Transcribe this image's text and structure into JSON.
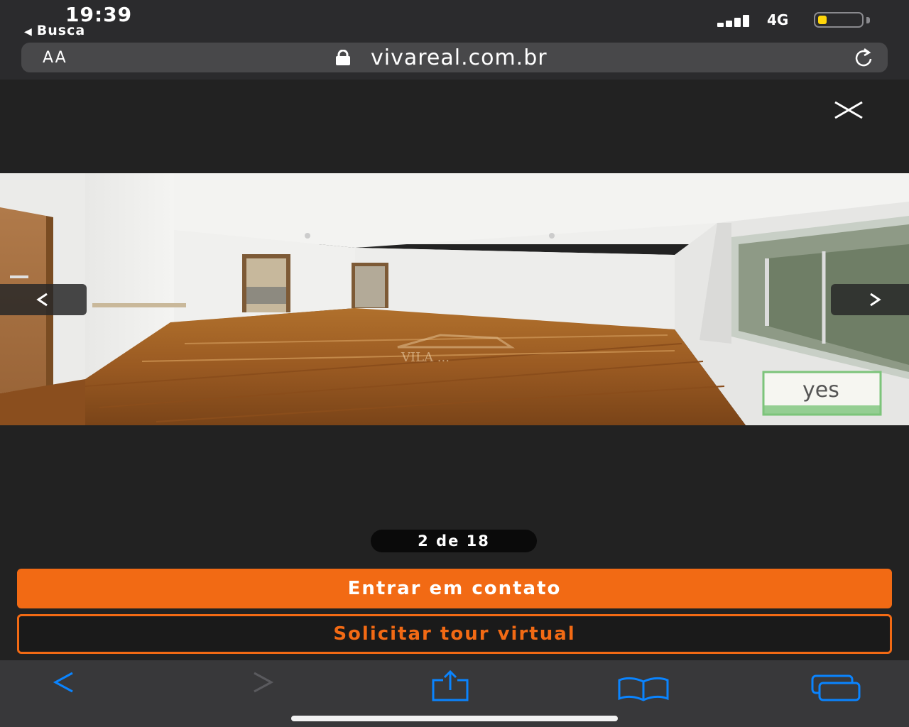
{
  "status_bar": {
    "time": "19:39",
    "back_app": "Busca",
    "network": "4G",
    "battery_level": 0.2
  },
  "url_bar": {
    "aa_label": "AA",
    "url": "vivareal.com.br"
  },
  "viewer": {
    "counter": "2 de 18",
    "watermark_center": "VILA ...",
    "watermark_corner": "yes"
  },
  "actions": {
    "contact_label": "Entrar em contato",
    "tour_label": "Solicitar tour virtual"
  },
  "colors": {
    "accent": "#f26a14",
    "ios_blue": "#0a84ff"
  },
  "icons": {
    "close": "close-icon",
    "prev": "chevron-left-icon",
    "next": "chevron-right-icon",
    "lock": "lock-icon",
    "reload": "reload-icon",
    "share": "share-icon",
    "bookmarks": "book-icon",
    "tabs": "tabs-icon"
  }
}
